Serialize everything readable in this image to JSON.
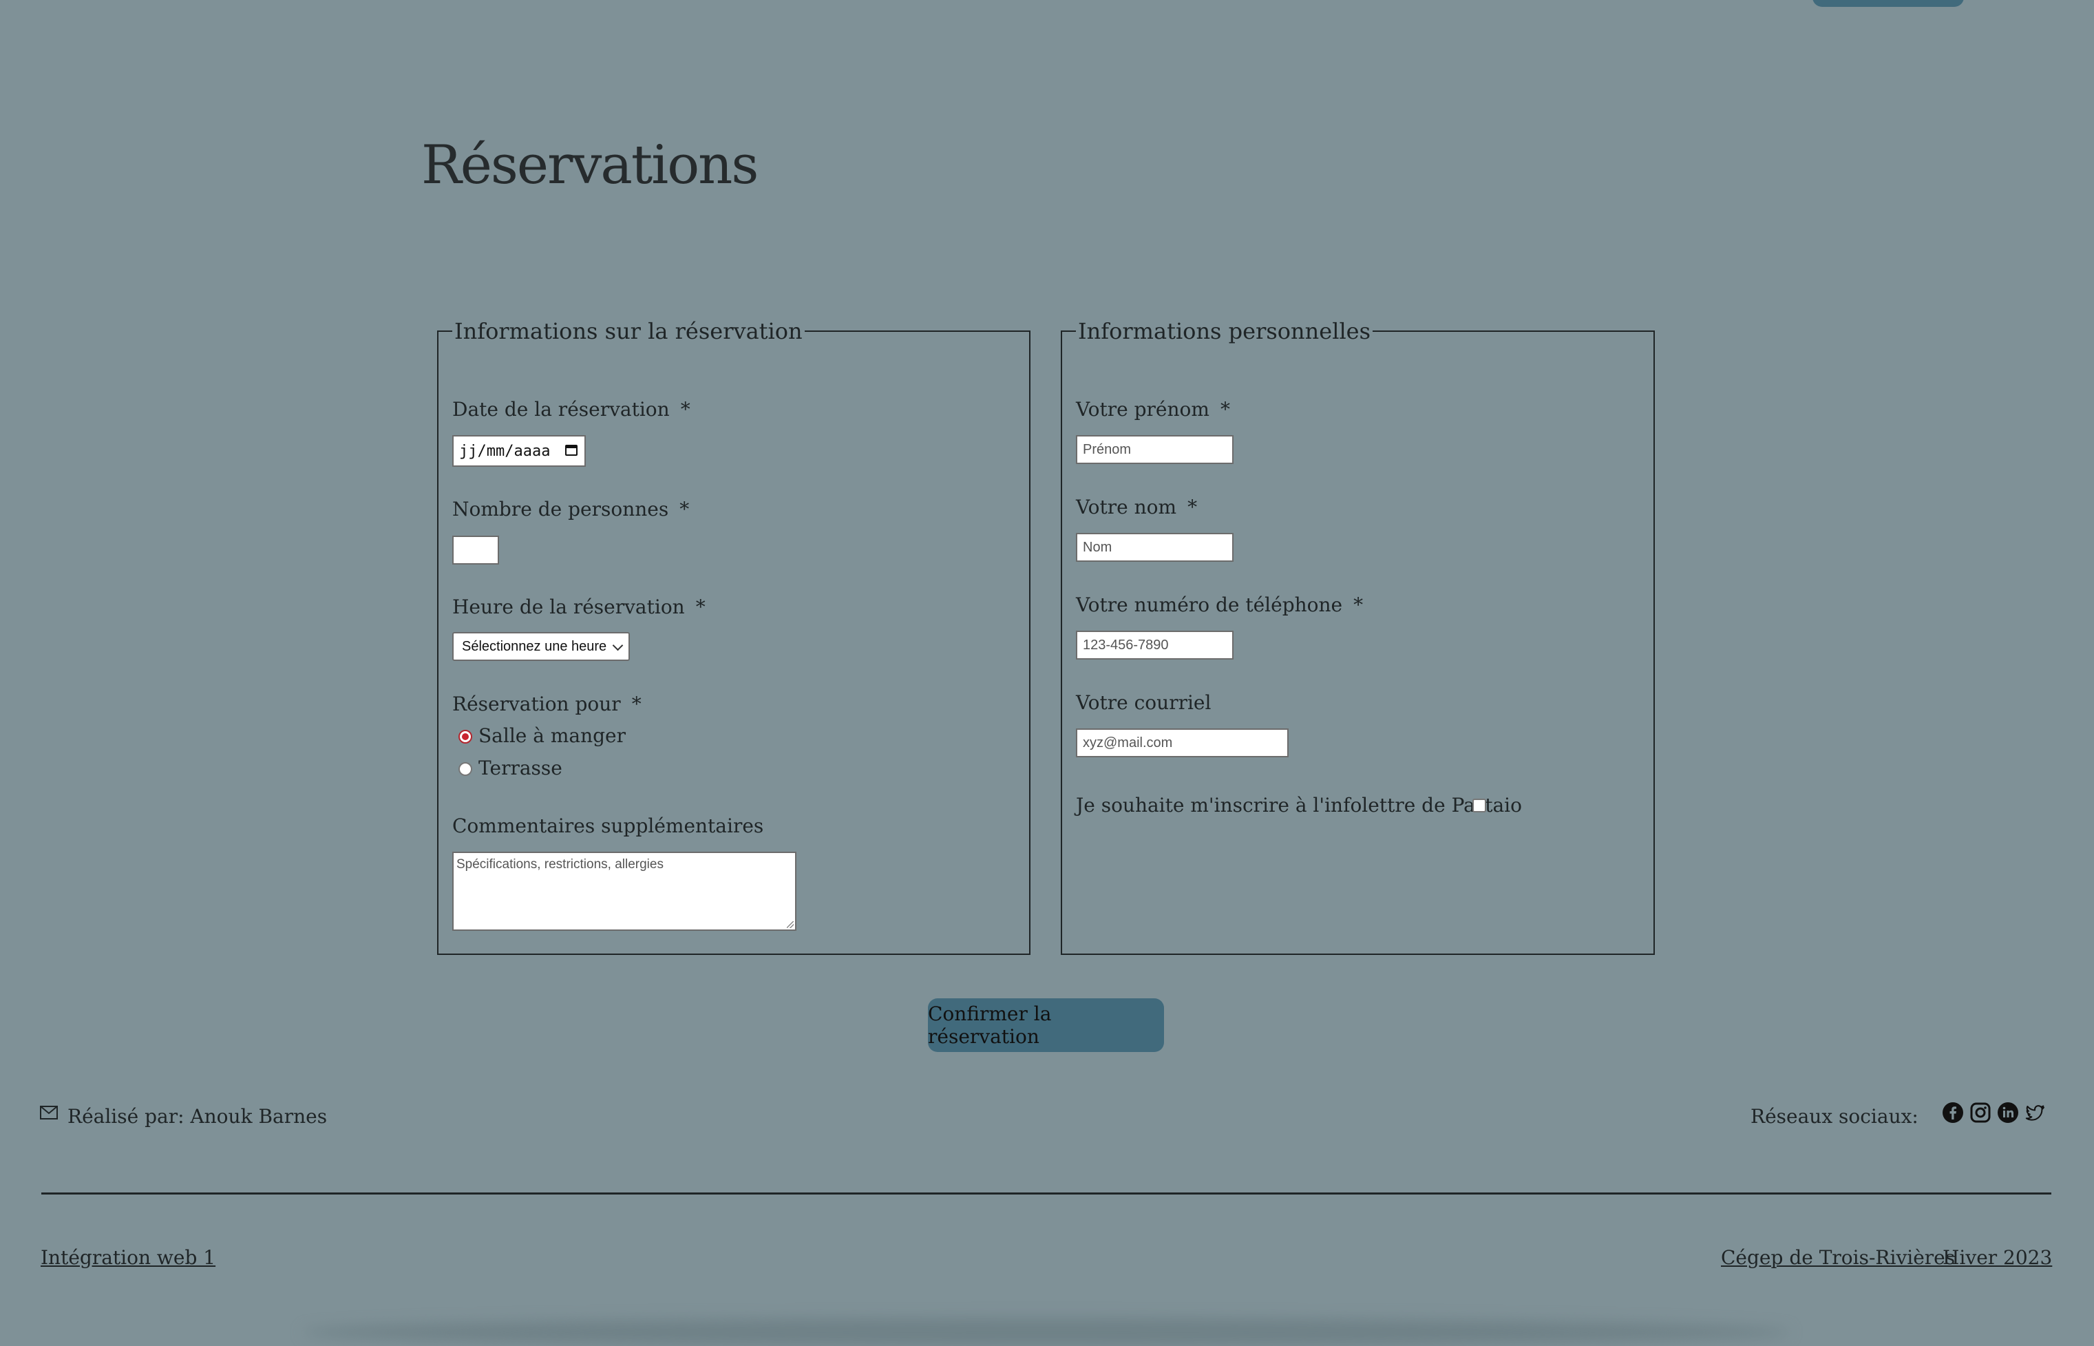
{
  "page": {
    "title": "Réservations"
  },
  "colors": {
    "background": "#7f9197",
    "accent_button": "#416a7c",
    "radio_selected": "#c9242f"
  },
  "reservation_info": {
    "legend": "Informations sur la réservation",
    "date_label": "Date de la réservation",
    "date_placeholder": "jj/mm/aaaa",
    "people_label": "Nombre de personnes",
    "people_value": "",
    "time_label": "Heure de la réservation",
    "time_selected": "Sélectionnez une heure",
    "for_label": "Réservation pour",
    "options": [
      {
        "label": "Salle à manger",
        "checked": true
      },
      {
        "label": "Terrasse",
        "checked": false
      }
    ],
    "comments_label": "Commentaires supplémentaires",
    "comments_placeholder": "Spécifications, restrictions, allergies",
    "required_mark": "*"
  },
  "personal_info": {
    "legend": "Informations personnelles",
    "firstname_label": "Votre prénom",
    "firstname_placeholder": "Prénom",
    "lastname_label": "Votre nom",
    "lastname_placeholder": "Nom",
    "phone_label": "Votre numéro de téléphone",
    "phone_placeholder": "123-456-7890",
    "email_label": "Votre courriel",
    "email_placeholder": "xyz@mail.com",
    "newsletter_label": "Je souhaite m'inscrire à l'infolettre de Pastaio",
    "newsletter_checked": false,
    "required_mark": "*"
  },
  "submit": {
    "label": "Confirmer la réservation"
  },
  "footer": {
    "author": "Réalisé par: Anouk Barnes",
    "social_label": "Réseaux sociaux:",
    "social_icons": [
      "facebook-icon",
      "instagram-icon",
      "linkedin-icon",
      "twitter-icon"
    ],
    "course_link": "Intégration web 1",
    "school_link": "Cégep de Trois-Rivières",
    "term_link": "Hiver 2023"
  }
}
